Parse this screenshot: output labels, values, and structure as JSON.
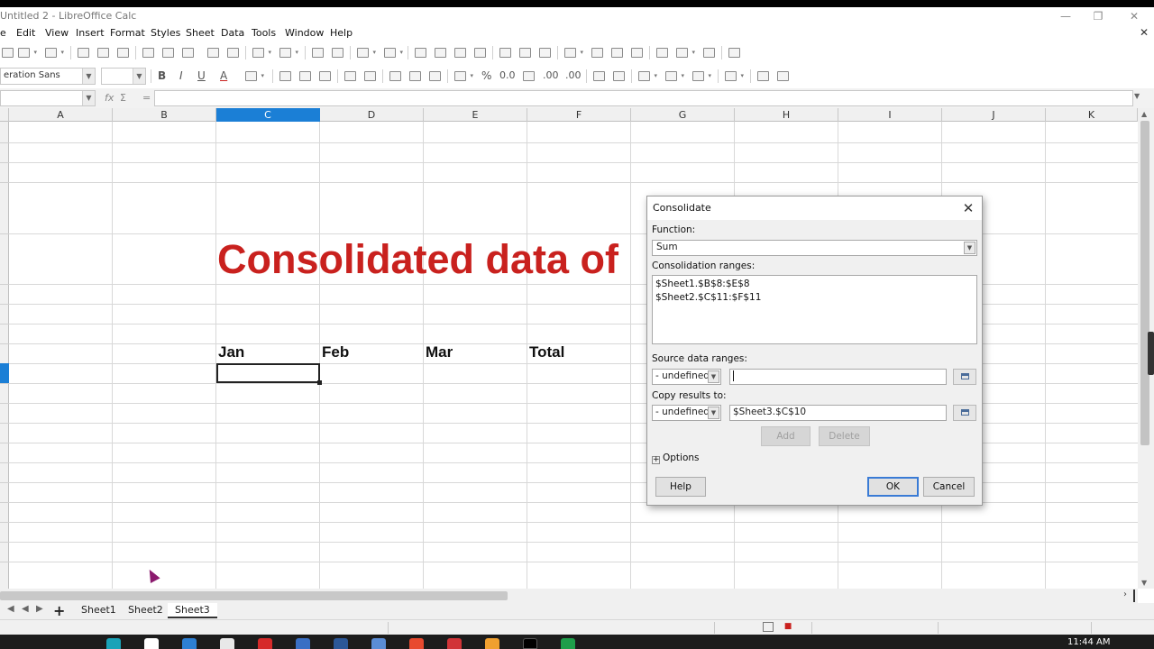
{
  "window": {
    "title": "Untitled 2 - LibreOffice Calc",
    "minimize": "—",
    "restore": "❐",
    "close": "✕"
  },
  "menu": {
    "items": [
      "e",
      "Edit",
      "View",
      "Insert",
      "Format",
      "Styles",
      "Sheet",
      "Data",
      "Tools",
      "Window",
      "Help"
    ],
    "close": "✕"
  },
  "format_toolbar": {
    "font_name": "eration Sans",
    "font_size": "",
    "bold": "B",
    "italic": "I",
    "underline": "U",
    "font_color": "A",
    "percent": "%",
    "decimal": "0.0",
    "add_decimal": ".00",
    "remove_decimal": ".00"
  },
  "formula": {
    "name_box": "",
    "fx": "fx",
    "sigma": "Σ",
    "equals": "=",
    "content": ""
  },
  "columns": [
    "A",
    "B",
    "C",
    "D",
    "E",
    "F",
    "G",
    "H",
    "I",
    "J",
    "K"
  ],
  "selected_column": "C",
  "cells": {
    "title": "Consolidated data of ",
    "headers": [
      "Jan",
      "Feb",
      "Mar",
      "Total"
    ]
  },
  "sheet_tabs": {
    "nav": [
      "◀",
      "◀",
      "▶",
      "▶"
    ],
    "add": "+",
    "tabs": [
      "Sheet1",
      "Sheet2",
      "Sheet3"
    ],
    "active": "Sheet3"
  },
  "taskbar": {
    "clock": "11:44 AM"
  },
  "dialog": {
    "title": "Consolidate",
    "close": "✕",
    "function_label": "Function:",
    "function_value": "Sum",
    "ranges_label": "Consolidation ranges:",
    "ranges": [
      "$Sheet1.$B$8:$E$8",
      "$Sheet2.$C$11:$F$11"
    ],
    "source_label": "Source data ranges:",
    "source_select": "- undefined -",
    "source_value": "",
    "copy_label": "Copy results to:",
    "copy_select": "- undefined -",
    "copy_value": "$Sheet3.$C$10",
    "add": "Add",
    "delete": "Delete",
    "options_toggle": "+",
    "options": "Options",
    "help": "Help",
    "ok": "OK",
    "cancel": "Cancel"
  },
  "colors": {
    "title_text": "#c9211e",
    "selection": "#1b7fd6"
  }
}
